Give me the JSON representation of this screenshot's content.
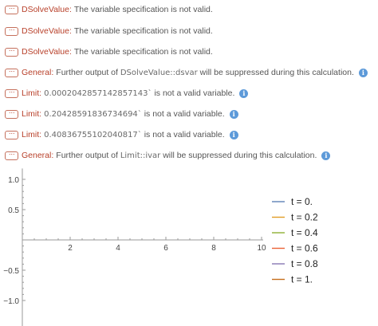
{
  "messages": [
    {
      "symbol": "DSolveValue",
      "segments": [
        {
          "t": "The variable specification is not valid.",
          "c": false
        }
      ],
      "info": false
    },
    {
      "symbol": "DSolveValue",
      "segments": [
        {
          "t": "The variable specification is not valid.",
          "c": false
        }
      ],
      "info": false
    },
    {
      "symbol": "DSolveValue",
      "segments": [
        {
          "t": "The variable specification is not valid.",
          "c": false
        }
      ],
      "info": false
    },
    {
      "symbol": "General",
      "segments": [
        {
          "t": "Further output of ",
          "c": false
        },
        {
          "t": "DSolveValue::dsvar",
          "c": true
        },
        {
          "t": " will be suppressed during this calculation.",
          "c": false
        }
      ],
      "info": true
    },
    {
      "symbol": "Limit",
      "segments": [
        {
          "t": "0.0002042857142857143`",
          "c": true
        },
        {
          "t": " is not a valid variable.",
          "c": false
        }
      ],
      "info": true
    },
    {
      "symbol": "Limit",
      "segments": [
        {
          "t": "0.20428591836734694`",
          "c": true
        },
        {
          "t": " is not a valid variable.",
          "c": false
        }
      ],
      "info": true
    },
    {
      "symbol": "Limit",
      "segments": [
        {
          "t": "0.40836755102040817`",
          "c": true
        },
        {
          "t": " is not a valid variable.",
          "c": false
        }
      ],
      "info": true
    },
    {
      "symbol": "General",
      "segments": [
        {
          "t": "Further output of ",
          "c": false
        },
        {
          "t": "Limit::ivar",
          "c": true
        },
        {
          "t": " will be suppressed during this calculation.",
          "c": false
        }
      ],
      "info": true
    }
  ],
  "dots_glyph": "···",
  "info_glyph": "i",
  "chart_data": {
    "type": "line",
    "title": "",
    "xlabel": "",
    "ylabel": "",
    "xlim": [
      0,
      10
    ],
    "ylim": [
      -1.1,
      1.1
    ],
    "x_ticks": [
      {
        "v": 2,
        "label": "2"
      },
      {
        "v": 4,
        "label": "4"
      },
      {
        "v": 6,
        "label": "6"
      },
      {
        "v": 8,
        "label": "8"
      },
      {
        "v": 10,
        "label": "10"
      }
    ],
    "y_ticks": [
      {
        "v": 1.0,
        "label": "1.0"
      },
      {
        "v": 0.5,
        "label": "0.5"
      },
      {
        "v": -0.5,
        "label": "−0.5"
      },
      {
        "v": -1.0,
        "label": "−1.0"
      }
    ],
    "grid": false,
    "legend_position": "right",
    "series": [
      {
        "name": "t = 0.",
        "color": "#5e81b5",
        "values": []
      },
      {
        "name": "t = 0.2",
        "color": "#e19c24",
        "values": []
      },
      {
        "name": "t = 0.4",
        "color": "#8fb032",
        "values": []
      },
      {
        "name": "t = 0.6",
        "color": "#eb6235",
        "values": []
      },
      {
        "name": "t = 0.8",
        "color": "#8778b3",
        "values": []
      },
      {
        "name": "t = 1.",
        "color": "#c56e1a",
        "values": []
      }
    ]
  }
}
